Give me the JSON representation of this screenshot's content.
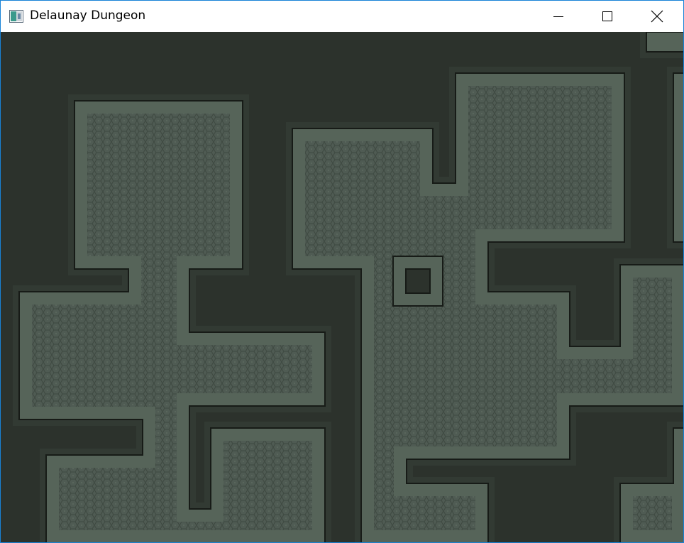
{
  "window": {
    "title": "Delaunay Dungeon",
    "icon": "dungeon-app-icon",
    "controls": {
      "minimize": "minimize-icon",
      "maximize": "maximize-icon",
      "close": "close-icon"
    }
  },
  "colors": {
    "background": "#2c322c",
    "floor": "#4f5b53",
    "floor_pattern": "#3e4941",
    "wall_light": "#566459",
    "wall_dark": "#3a443c",
    "outline": "#171b17",
    "window_border": "#1883d7"
  },
  "scene": {
    "rooms": [
      "room-top-left",
      "room-center",
      "room-top-right",
      "room-right",
      "room-left",
      "room-bottom-left",
      "room-bottom-center",
      "room-bottom-right"
    ],
    "pillars": [
      "pillar-center"
    ]
  }
}
